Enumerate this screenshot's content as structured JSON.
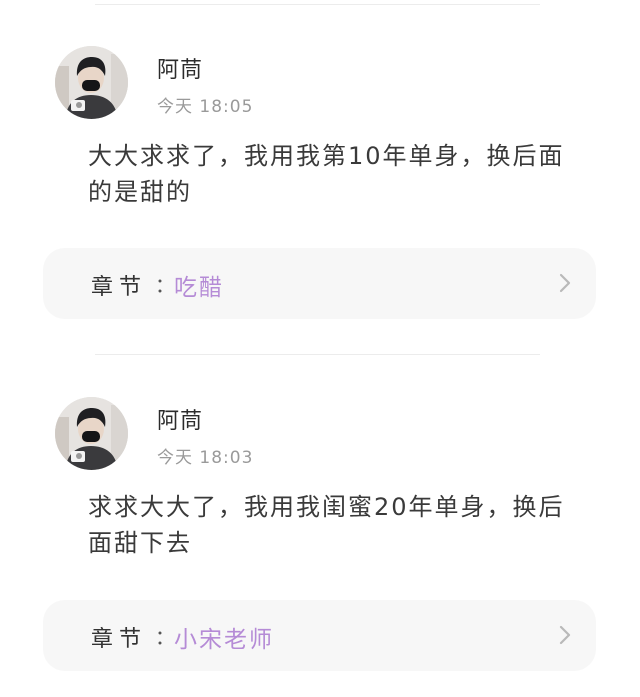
{
  "colors": {
    "accent": "#b58bd6",
    "card_bg": "#f7f7f7",
    "time_text": "#9a9a9a"
  },
  "comments": [
    {
      "username": "阿茼",
      "time": "今天 18:05",
      "content": "大大求求了，我用我第10年单身，换后面的是甜的",
      "chapter_label": "章节",
      "chapter_colon": "：",
      "chapter_name": "吃醋",
      "chevron_icon": "chevron-right-icon"
    },
    {
      "username": "阿茼",
      "time": "今天 18:03",
      "content": "求求大大了，我用我闺蜜20年单身，换后面甜下去",
      "chapter_label": "章节",
      "chapter_colon": "：",
      "chapter_name": "小宋老师",
      "chevron_icon": "chevron-right-icon"
    }
  ]
}
